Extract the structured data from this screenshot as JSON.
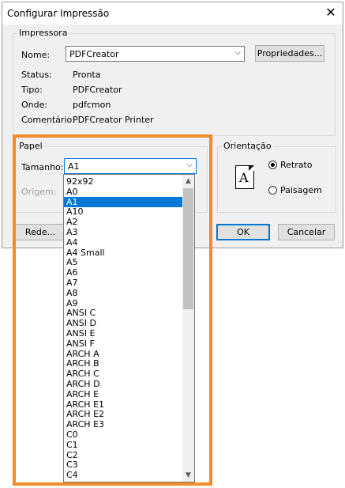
{
  "window": {
    "title": "Configurar Impressão",
    "close_symbol": "✕"
  },
  "printer": {
    "legend": "Impressora",
    "name_label": "Nome:",
    "name_value": "PDFCreator",
    "properties_button": "Propriedades...",
    "status_label": "Status:",
    "status_value": "Pronta",
    "type_label": "Tipo:",
    "type_value": "PDFCreator",
    "where_label": "Onde:",
    "where_value": "pdfcmon",
    "comment_label": "Comentário:",
    "comment_value": "PDFCreator Printer"
  },
  "paper": {
    "legend": "Papel",
    "size_label": "Tamanho:",
    "size_value": "A1",
    "source_label": "Origem:",
    "options": [
      "92x92",
      "A0",
      "A1",
      "A10",
      "A2",
      "A3",
      "A4",
      "A4 Small",
      "A5",
      "A6",
      "A7",
      "A8",
      "A9",
      "ANSI C",
      "ANSI D",
      "ANSI E",
      "ANSI F",
      "ARCH A",
      "ARCH B",
      "ARCH C",
      "ARCH D",
      "ARCH E",
      "ARCH E1",
      "ARCH E2",
      "ARCH E3",
      "C0",
      "C1",
      "C2",
      "C3",
      "C4"
    ],
    "selected_index": 2
  },
  "orientation": {
    "legend": "Orientação",
    "portrait_label": "Retrato",
    "landscape_label": "Paisagem",
    "selected": "portrait",
    "icon_letter": "A"
  },
  "buttons": {
    "network": "Rede...",
    "ok": "OK",
    "cancel": "Cancelar"
  },
  "colors": {
    "selection": "#0078d7",
    "highlight_border": "#f28c28"
  }
}
